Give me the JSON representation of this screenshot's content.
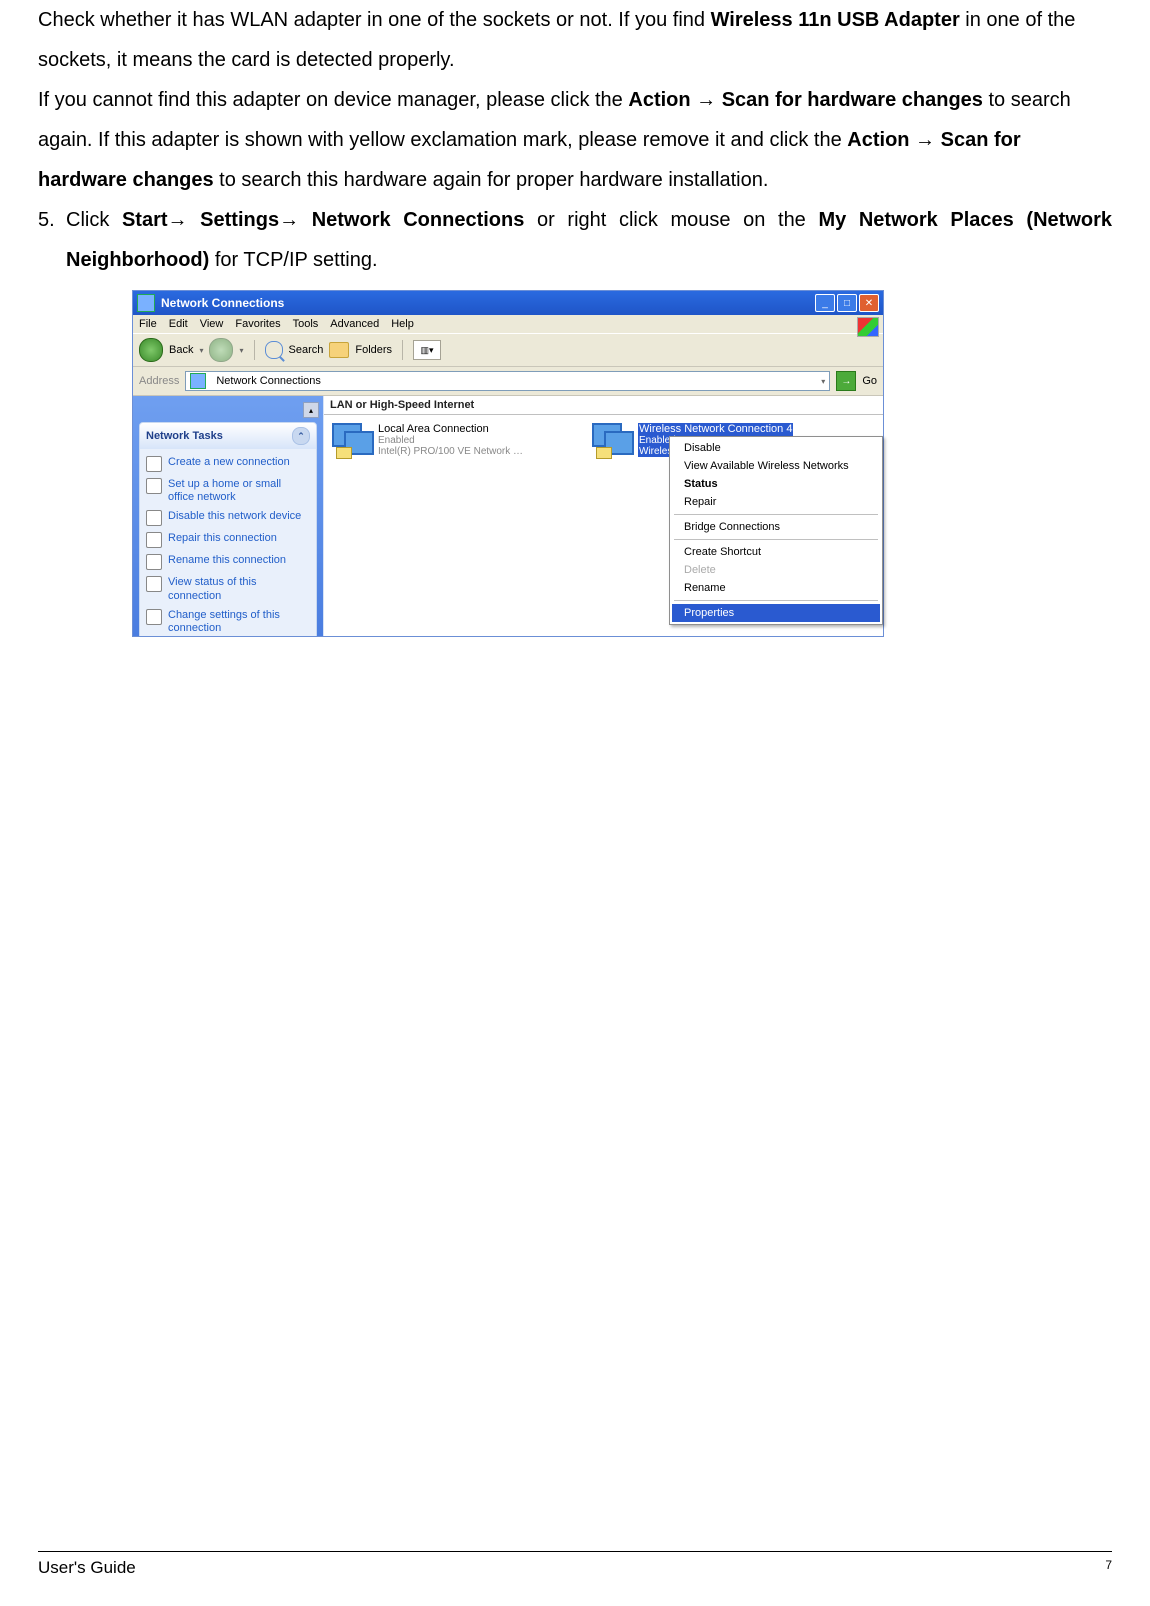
{
  "body": {
    "p1_a": "Check whether it has WLAN adapter in one of the sockets or not.  If you find ",
    "p1_b": "Wireless 11n USB Adapter",
    "p1_c": " in one of the sockets, it means the card is detected properly.",
    "p2_a": "If you cannot find this adapter on device manager, please click the ",
    "p2_b": "Action → Scan for hardware changes",
    "p2_c": " to search again. If this adapter is shown with yellow exclamation mark, please remove it and click the ",
    "p2_d": "Action → Scan for hardware changes",
    "p2_e": " to search this hardware again for proper hardware installation.",
    "step5num": "5.",
    "s5_a": "Click ",
    "s5_b": "Start→ Settings→ Network Connections",
    "s5_c": " or right click mouse on the ",
    "s5_d": "My Network Places (Network Neighborhood)",
    "s5_e": " for TCP/IP setting."
  },
  "win": {
    "title": "Network Connections",
    "menus": [
      "File",
      "Edit",
      "View",
      "Favorites",
      "Tools",
      "Advanced",
      "Help"
    ],
    "back": "Back",
    "search": "Search",
    "folders": "Folders",
    "views": "▥▾",
    "addr_label": "Address",
    "addr_value": "Network Connections",
    "go": "Go",
    "section": "LAN or High-Speed Internet",
    "tasks_title": "Network Tasks",
    "tasks": [
      "Create a new connection",
      "Set up a home or small office network",
      "Disable this network device",
      "Repair this connection",
      "Rename this connection",
      "View status of this connection",
      "Change settings of this connection"
    ],
    "lan": {
      "name": "Local Area Connection",
      "status": "Enabled",
      "device": "Intel(R) PRO/100 VE Network …"
    },
    "wlan": {
      "name": "Wireless Network Connection 4",
      "status": "Enabled",
      "device": "Wireless 11…"
    },
    "ctx": {
      "disable": "Disable",
      "view": "View Available Wireless Networks",
      "status": "Status",
      "repair": "Repair",
      "bridge": "Bridge Connections",
      "shortcut": "Create Shortcut",
      "delete": "Delete",
      "rename": "Rename",
      "props": "Properties"
    }
  },
  "footer": {
    "left": "User's Guide",
    "right": "7"
  }
}
